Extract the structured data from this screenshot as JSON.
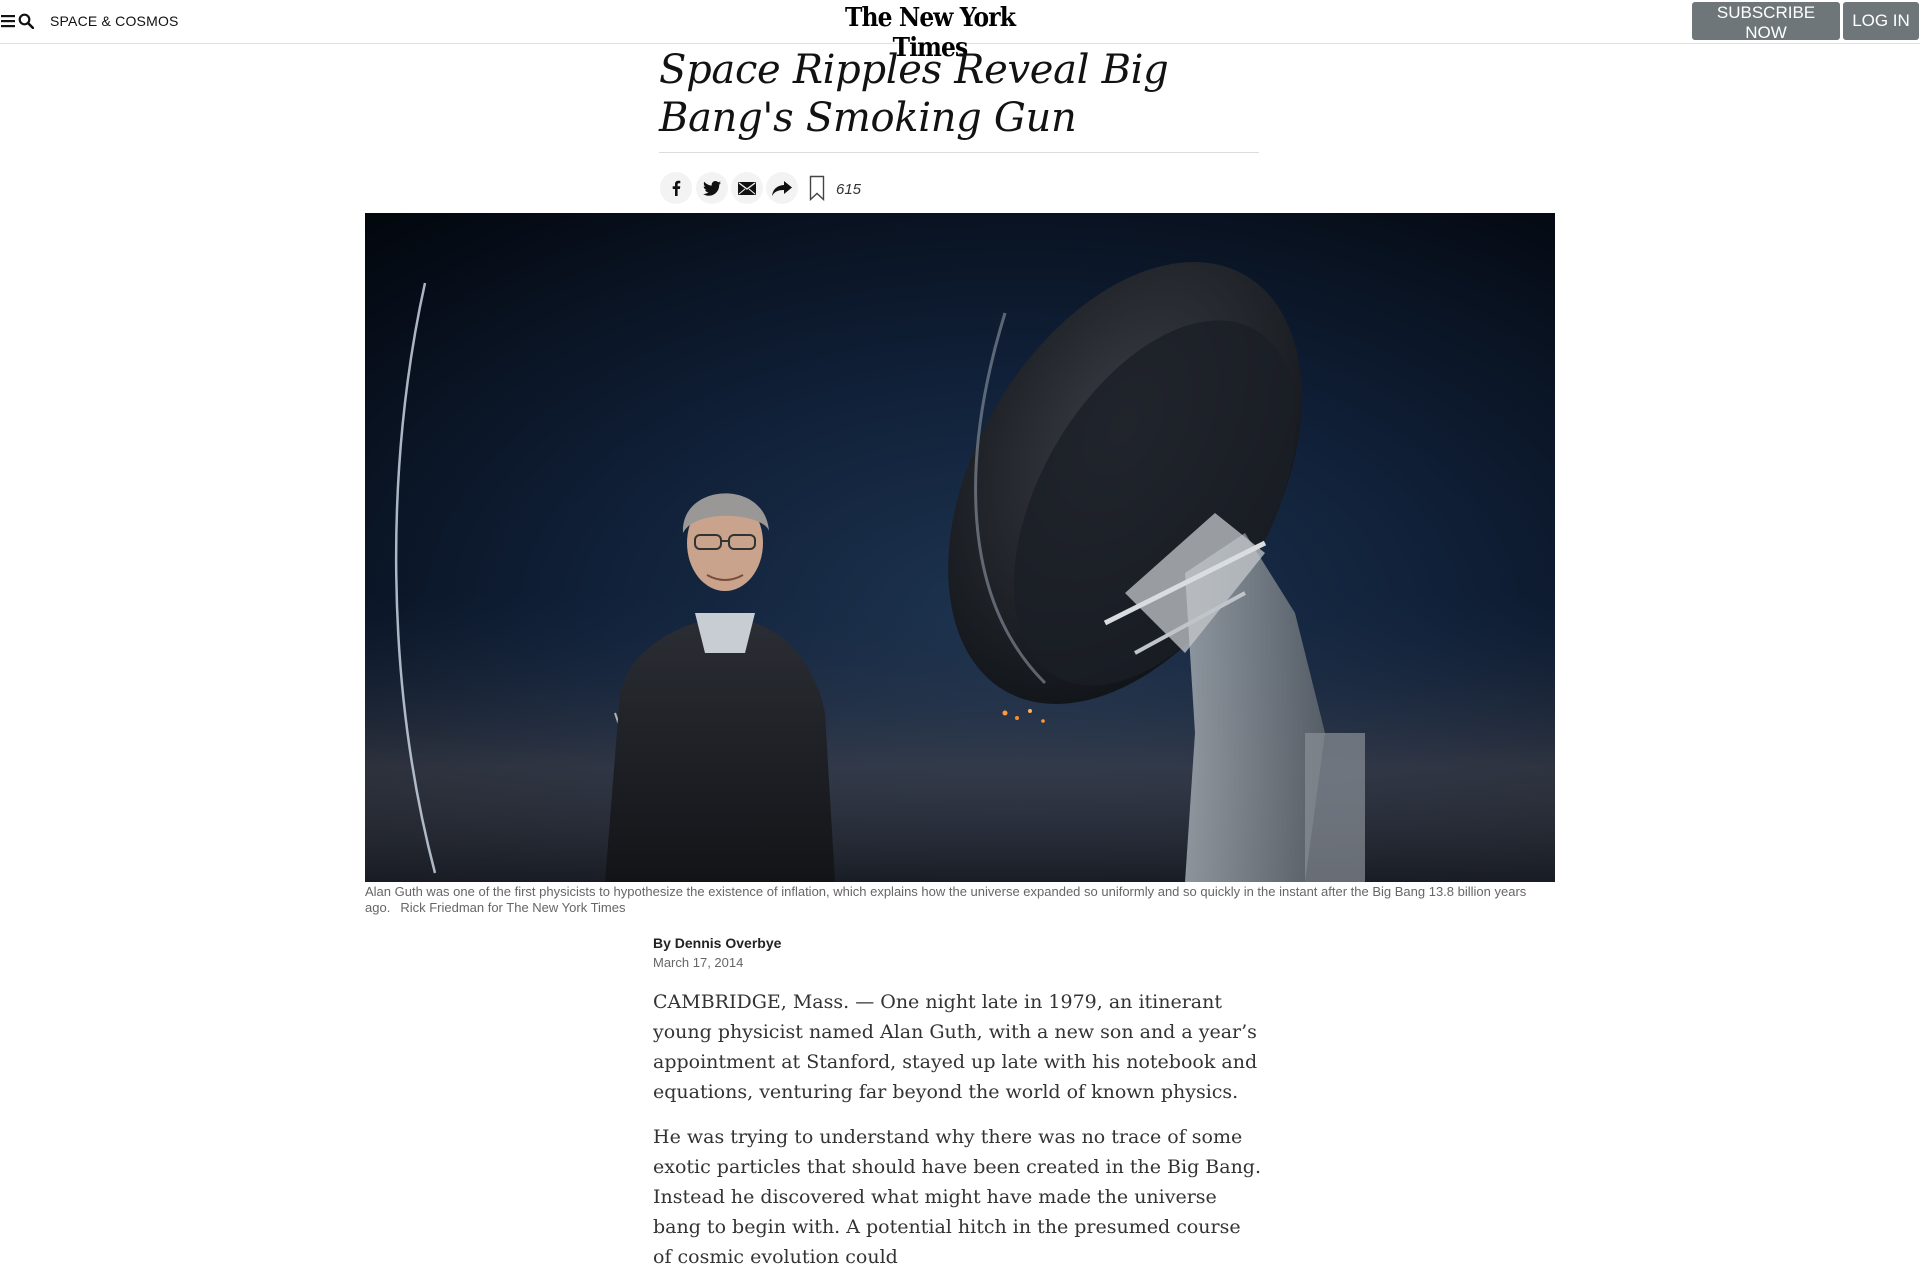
{
  "header": {
    "menu_icon": "hamburger-menu-icon",
    "search_icon": "search-icon",
    "section": "SPACE & COSMOS",
    "masthead": "The New York Times",
    "subscribe_label": "SUBSCRIBE NOW",
    "login_label": "LOG IN",
    "button_color": "#6e7679"
  },
  "article": {
    "headline": "Space Ripples Reveal Big Bang's Smoking Gun",
    "share": {
      "icons": [
        "facebook-icon",
        "twitter-icon",
        "email-icon",
        "share-arrow-icon",
        "bookmark-icon"
      ],
      "comment_count": "615"
    },
    "image": {
      "alt_subject": "telescope-night-photo",
      "caption": "Alan Guth was one of the first physicists to hypothesize the existence of inflation, which explains how the universe expanded so uniformly and so quickly in the instant after the Big Bang 13.8 billion years ago.",
      "credit": "Rick Friedman for The New York Times"
    },
    "byline": "By Dennis Overbye",
    "date": "March 17, 2014",
    "paragraphs": [
      "CAMBRIDGE, Mass. — One night late in 1979, an itinerant young physicist named Alan Guth, with a new son and a year’s appointment at Stanford, stayed up late with his notebook and equations, venturing far beyond the world of known physics.",
      "He was trying to understand why there was no trace of some exotic particles that should have been created in the Big Bang. Instead he discovered what might have made the universe bang to begin with. A potential hitch in the presumed course of cosmic evolution could"
    ]
  }
}
